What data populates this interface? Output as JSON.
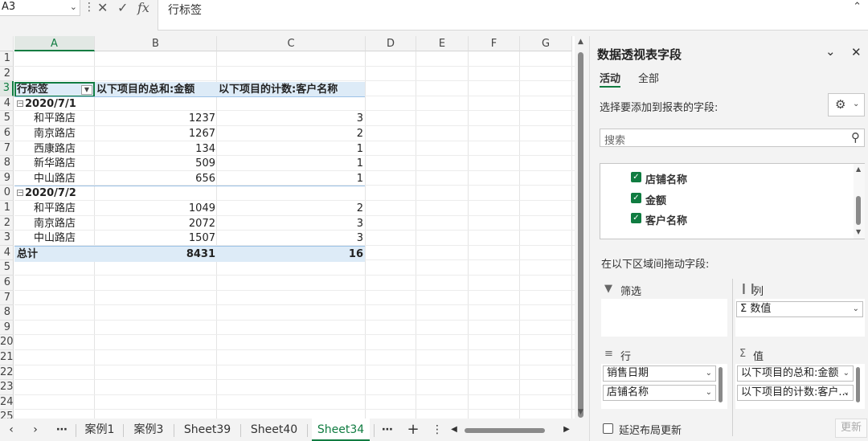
{
  "formula_bar": {
    "name_box": "A3",
    "fx": "fx",
    "content": "行标签"
  },
  "columns": [
    "A",
    "B",
    "C",
    "D",
    "E",
    "F",
    "G"
  ],
  "rows": [
    "1",
    "2",
    "3",
    "4",
    "5",
    "6",
    "7",
    "8",
    "9",
    "0",
    "1",
    "2",
    "3",
    "4",
    "5",
    "6",
    "7",
    "8",
    "9",
    "20",
    "21",
    "22",
    "23",
    "24",
    "25"
  ],
  "pivot": {
    "header": [
      "行标签",
      "以下项目的总和:金额",
      "以下项目的计数:客户名称"
    ],
    "groups": [
      {
        "label": "2020/7/1",
        "items": [
          {
            "name": "和平路店",
            "sum": "1237",
            "count": "3"
          },
          {
            "name": "南京路店",
            "sum": "1267",
            "count": "2"
          },
          {
            "name": "西康路店",
            "sum": "134",
            "count": "1"
          },
          {
            "name": "新华路店",
            "sum": "509",
            "count": "1"
          },
          {
            "name": "中山路店",
            "sum": "656",
            "count": "1"
          }
        ]
      },
      {
        "label": "2020/7/2",
        "items": [
          {
            "name": "和平路店",
            "sum": "1049",
            "count": "2"
          },
          {
            "name": "南京路店",
            "sum": "2072",
            "count": "3"
          },
          {
            "name": "中山路店",
            "sum": "1507",
            "count": "3"
          }
        ]
      }
    ],
    "total": {
      "label": "总计",
      "sum": "8431",
      "count": "16"
    }
  },
  "sheet_tabs": {
    "items": [
      "案例1",
      "案例3",
      "Sheet39",
      "Sheet40",
      "Sheet34"
    ],
    "active": "Sheet34"
  },
  "panel": {
    "title": "数据透视表字段",
    "tabs": [
      "活动",
      "全部"
    ],
    "choose_label": "选择要添加到报表的字段:",
    "search_placeholder": "搜索",
    "fields": [
      "店铺名称",
      "金额",
      "客户名称"
    ],
    "drag_label": "在以下区域间拖动字段:",
    "areas": {
      "filter": "筛选",
      "columns": "列",
      "rows": "行",
      "values": "值"
    },
    "columns_items": [
      "Σ 数值"
    ],
    "rows_items": [
      "销售日期",
      "店铺名称"
    ],
    "values_items": [
      "以下项目的总和:金额",
      "以下项目的计数:客户..."
    ],
    "defer_label": "延迟布局更新",
    "update_button": "更新"
  },
  "colors": {
    "accent": "#107c41",
    "header_band": "#ddebf7",
    "band_line": "#9bc2e6"
  }
}
